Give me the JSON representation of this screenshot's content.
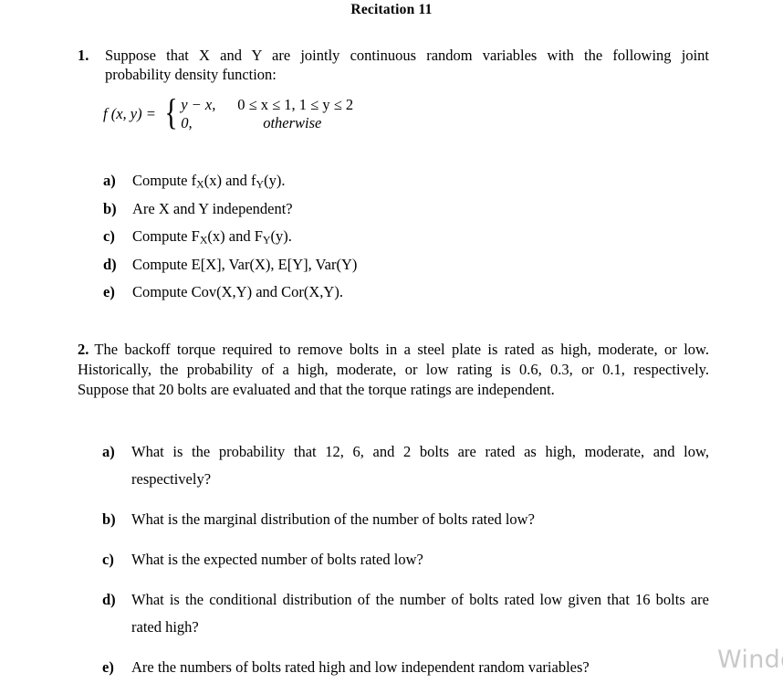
{
  "document": {
    "title": "Recitation 11"
  },
  "problem1": {
    "number": "1.",
    "stem_line1": "Suppose that X and Y are jointly continuous random variables with the following joint",
    "stem_line2": "probability density function:",
    "formula": {
      "label": "f (x, y) = ",
      "case1_expr": "y − x,",
      "case1_cond": "0 ≤ x ≤ 1, 1 ≤ y ≤ 2",
      "case2_expr": "0,",
      "case2_cond": "otherwise"
    },
    "items": [
      {
        "marker": "a)",
        "text_before": "Compute f",
        "sub1": "X",
        "mid": "(x) and f",
        "sub2": "Y",
        "text_after": "(y)."
      },
      {
        "marker": "b)",
        "text": "Are X and Y independent?"
      },
      {
        "marker": "c)",
        "text_before": "Compute F",
        "sub1": "X",
        "mid": "(x) and F",
        "sub2": "Y",
        "text_after": "(y)."
      },
      {
        "marker": "d)",
        "text": "Compute E[X], Var(X), E[Y], Var(Y)"
      },
      {
        "marker": "e)",
        "text": "Compute Cov(X,Y) and Cor(X,Y)."
      }
    ]
  },
  "problem2": {
    "number": "2.",
    "para_line1": "The backoff torque required to remove bolts in a steel plate is rated as high, moderate, or low.",
    "para_line2": "Historically, the probability of a high, moderate, or low rating is 0.6, 0.3, or 0.1, respectively.",
    "para_line3": "Suppose that 20 bolts are evaluated and that the torque ratings are independent.",
    "items": [
      {
        "marker": "a)",
        "line1": "What is the probability that 12, 6, and 2 bolts are rated as high, moderate, and low,",
        "line2": "respectively?"
      },
      {
        "marker": "b)",
        "line1": "What is the marginal distribution of the number of bolts rated low?"
      },
      {
        "marker": "c)",
        "line1": "What is the expected number of bolts rated low?"
      },
      {
        "marker": "d)",
        "line1": "What is the conditional distribution of the number of bolts rated low given that 16 bolts are",
        "line2": "rated high?"
      },
      {
        "marker": "e)",
        "line1": "Are the numbers of bolts rated high and low independent random variables?"
      }
    ]
  },
  "watermark": {
    "text": "Windows"
  }
}
